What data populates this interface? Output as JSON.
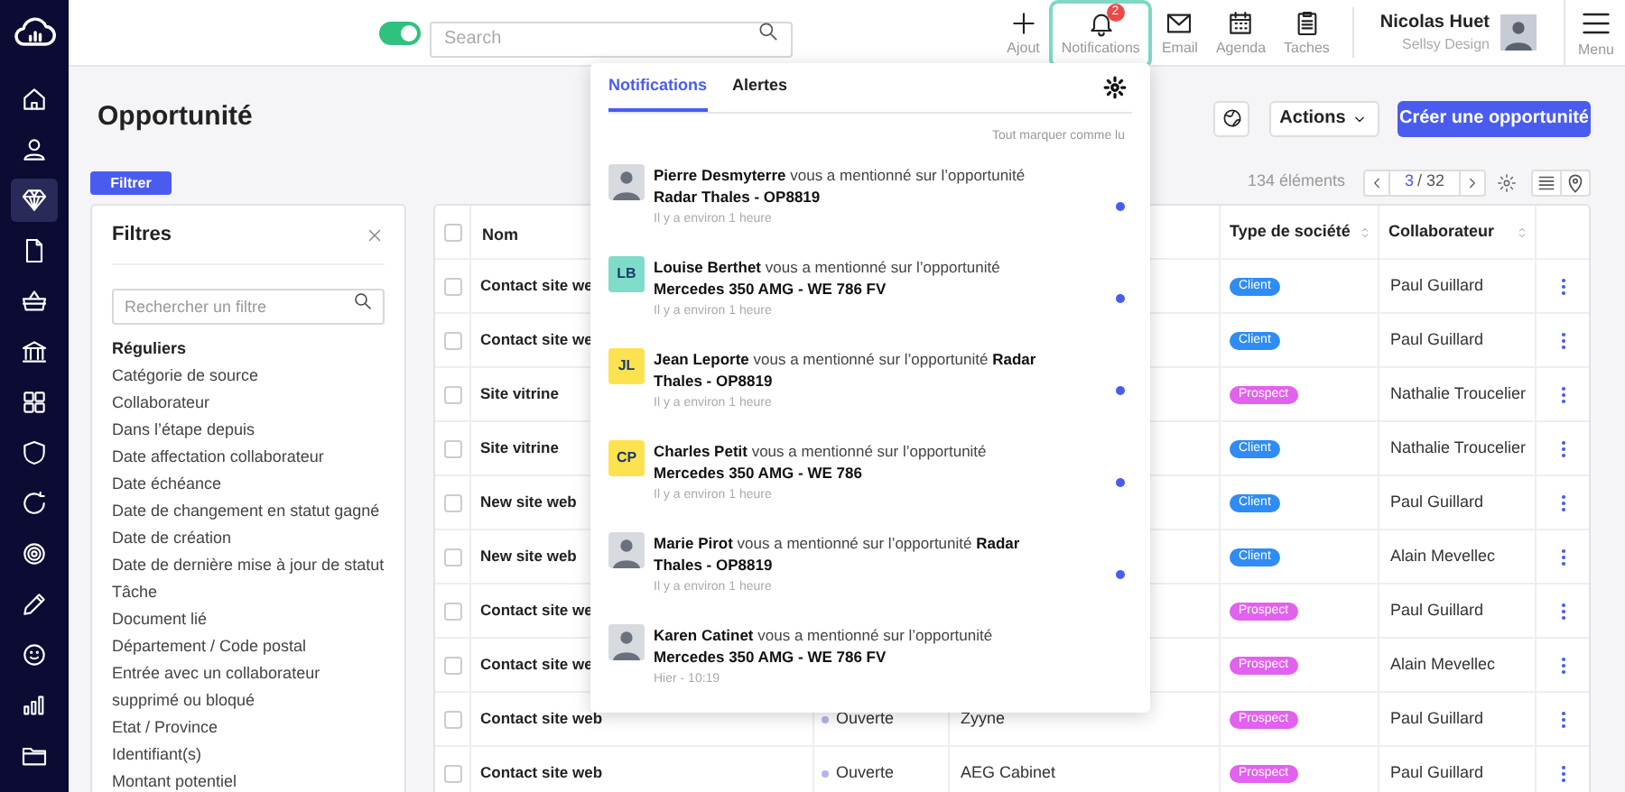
{
  "sidebar": {
    "items": [
      {
        "selected": false
      },
      {
        "selected": false
      },
      {
        "selected": true
      },
      {
        "selected": false
      },
      {
        "selected": false
      },
      {
        "selected": false
      },
      {
        "selected": false
      },
      {
        "selected": false
      },
      {
        "selected": false
      },
      {
        "selected": false
      },
      {
        "selected": false
      },
      {
        "selected": false
      },
      {
        "selected": false
      },
      {
        "selected": false
      }
    ]
  },
  "topbar": {
    "toggle": {
      "on": true
    },
    "search": {
      "placeholder": "Search"
    },
    "nav": [
      {
        "label": "Ajout",
        "selected": false
      },
      {
        "label": "Notifications",
        "selected": true,
        "badge": "2"
      },
      {
        "label": "Email",
        "selected": false
      },
      {
        "label": "Agenda",
        "selected": false
      },
      {
        "label": "Taches",
        "selected": false
      }
    ],
    "user": {
      "name": "Nicolas Huet",
      "company": "Sellsy Design"
    },
    "menu": {
      "label": "Menu"
    }
  },
  "page": {
    "title": "Opportunité",
    "actions_button": "Actions",
    "create_button": "Créer une opportunité",
    "filter_button": "Filtrer",
    "count": "134 éléments",
    "pager": {
      "current": "3",
      "total": "/ 32"
    }
  },
  "filters": {
    "title": "Filtres",
    "search_placeholder": "Rechercher un filtre",
    "section": "Réguliers",
    "items": [
      "Catégorie de source",
      "Collaborateur",
      "Dans l’étape depuis",
      "Date affectation collaborateur",
      "Date échéance",
      "Date de changement en statut gagné",
      "Date de création",
      "Date de dernière mise à jour de statut",
      "Tâche",
      "Document lié",
      "Département / Code postal",
      "Entrée avec un collaborateur supprimé ou bloqué",
      "Etat / Province",
      "Identifiant(s)",
      "Montant potentiel"
    ]
  },
  "table": {
    "columns": [
      "Nom",
      "Type de société",
      "Collaborateur"
    ],
    "select_all": {
      "checked": false
    },
    "rows": [
      {
        "checked": false,
        "name": "Contact site we",
        "type": {
          "label": "Client",
          "color": "#2f8cf5"
        },
        "collaborator": "Paul Guillard"
      },
      {
        "checked": false,
        "name": "Contact site we",
        "type": {
          "label": "Client",
          "color": "#2f8cf5"
        },
        "collaborator": "Paul Guillard"
      },
      {
        "checked": false,
        "name": "Site vitrine",
        "type": {
          "label": "Prospect",
          "color": "#e261ee"
        },
        "collaborator": "Nathalie Troucelier"
      },
      {
        "checked": false,
        "name": "Site vitrine",
        "type": {
          "label": "Client",
          "color": "#2f8cf5"
        },
        "collaborator": "Nathalie Troucelier"
      },
      {
        "checked": false,
        "name": "New site web",
        "type": {
          "label": "Client",
          "color": "#2f8cf5"
        },
        "collaborator": "Paul Guillard"
      },
      {
        "checked": false,
        "name": "New site web",
        "type": {
          "label": "Client",
          "color": "#2f8cf5"
        },
        "collaborator": "Alain Mevellec"
      },
      {
        "checked": false,
        "name": "Contact site we",
        "type": {
          "label": "Prospect",
          "color": "#e261ee"
        },
        "collaborator": "Paul Guillard"
      },
      {
        "checked": false,
        "name": "Contact site we",
        "type": {
          "label": "Prospect",
          "color": "#e261ee"
        },
        "collaborator": "Alain Mevellec"
      },
      {
        "checked": false,
        "name": "Contact site web",
        "status": {
          "label": "Ouverte",
          "color": "#b3b5f0"
        },
        "company": "Zyyne",
        "type": {
          "label": "Prospect",
          "color": "#e261ee"
        },
        "collaborator": "Paul Guillard"
      },
      {
        "checked": false,
        "name": "Contact site web",
        "status": {
          "label": "Ouverte",
          "color": "#b3b5f0"
        },
        "company": "AEG Cabinet",
        "type": {
          "label": "Prospect",
          "color": "#e261ee"
        },
        "collaborator": "Paul Guillard"
      }
    ]
  },
  "notifications": {
    "tabs": [
      {
        "label": "Notifications",
        "selected": true
      },
      {
        "label": "Alertes",
        "selected": false
      }
    ],
    "mark_all": "Tout marquer comme lu",
    "items": [
      {
        "avatar": {
          "kind": "photo"
        },
        "text": "**Pierre Desmyterre** vous a mentionné sur l’opportunité **Radar Thales - OP8819**",
        "time": "Il y a environ 1 heure",
        "unread": true
      },
      {
        "avatar": {
          "kind": "initials",
          "initials": "LB",
          "color": "#7fdcc8"
        },
        "text": "**Louise Berthet** vous a mentionné sur l’opportunité **Mercedes 350 AMG - WE 786 FV**",
        "time": "Il y a environ 1 heure",
        "unread": true
      },
      {
        "avatar": {
          "kind": "initials",
          "initials": "JL",
          "color": "#fde24f"
        },
        "text": "**Jean Leporte** vous a mentionné sur l’opportunité **Radar Thales - OP8819**",
        "time": "Il y a environ 1 heure",
        "unread": true
      },
      {
        "avatar": {
          "kind": "initials",
          "initials": "CP",
          "color": "#fde24f"
        },
        "text": "**Charles Petit** vous a mentionné sur l’opportunité **Mercedes 350 AMG - WE 786**",
        "time": "Il y a environ 1 heure",
        "unread": true
      },
      {
        "avatar": {
          "kind": "photo"
        },
        "text": "**Marie Pirot** vous a mentionné sur l’opportunité **Radar Thales - OP8819**",
        "time": "Il y a environ 1 heure",
        "unread": true
      },
      {
        "avatar": {
          "kind": "photo"
        },
        "text": "**Karen Catinet** vous a mentionné sur l’opportunité **Mercedes 350 AMG - WE 786 FV**",
        "time": "Hier - 10:19",
        "unread": false
      }
    ]
  }
}
